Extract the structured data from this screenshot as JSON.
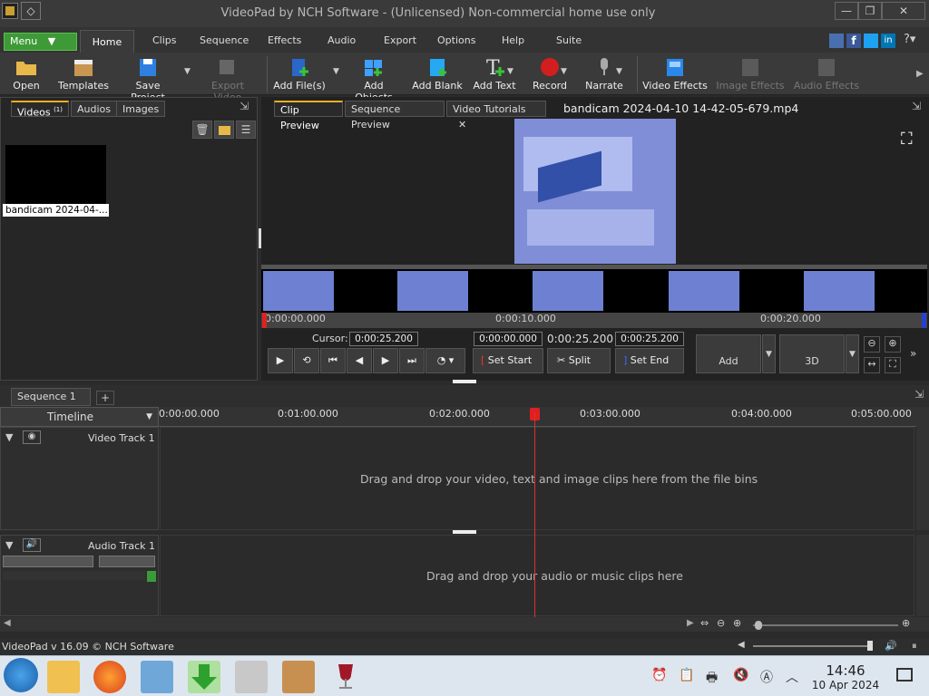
{
  "window": {
    "title": "VideoPad by NCH Software - (Unlicensed) Non-commercial home use only"
  },
  "menubar": {
    "menu_label": "Menu",
    "tabs": [
      "Home",
      "Clips",
      "Sequence",
      "Effects",
      "Audio",
      "Export",
      "Options",
      "Help",
      "Suite"
    ]
  },
  "toolbar": {
    "items": [
      {
        "label": "Open",
        "icon": "folder-icon"
      },
      {
        "label": "Templates",
        "icon": "templates-icon"
      },
      {
        "label": "Save Project",
        "icon": "floppy-icon"
      },
      {
        "label": "Export Video",
        "icon": "export-icon",
        "disabled": true
      },
      {
        "label": "Add File(s)",
        "icon": "add-file-icon"
      },
      {
        "label": "Add Objects",
        "icon": "add-objects-icon"
      },
      {
        "label": "Add Blank",
        "icon": "add-blank-icon"
      },
      {
        "label": "Add Text",
        "icon": "add-text-icon"
      },
      {
        "label": "Record",
        "icon": "record-icon"
      },
      {
        "label": "Narrate",
        "icon": "microphone-icon"
      },
      {
        "label": "Video Effects",
        "icon": "video-effects-icon"
      },
      {
        "label": "Image Effects",
        "icon": "image-effects-icon",
        "disabled": true
      },
      {
        "label": "Audio Effects",
        "icon": "audio-effects-icon",
        "disabled": true
      }
    ]
  },
  "bins": {
    "tabs": [
      "Videos",
      "Audios",
      "Images"
    ],
    "videos_count": "(1)",
    "clip_name": "bandicam 2024-04-..."
  },
  "preview": {
    "tabs": [
      "Clip Preview",
      "Sequence Preview",
      "Video Tutorials"
    ],
    "file_name": "bandicam 2024-04-10 14-42-05-679.mp4",
    "ruler": [
      "0:00:00.000",
      "0:00:10.000",
      "0:00:20.000"
    ],
    "cursor_label": "Cursor:",
    "cursor_value": "0:00:25.200",
    "start_value": "0:00:00.000",
    "duration_value": "0:00:25.200",
    "end_value": "0:00:25.200",
    "set_start": "Set Start",
    "split": "Split",
    "set_end": "Set End",
    "add": "Add",
    "three_d": "3D"
  },
  "sequence": {
    "tab": "Sequence 1",
    "timeline_label": "Timeline",
    "ruler": [
      "0:00:00.000",
      "0:01:00.000",
      "0:02:00.000",
      "0:03:00.000",
      "0:04:00.000",
      "0:05:00.000"
    ],
    "video_track": "Video Track 1",
    "video_hint": "Drag and drop your video, text and image clips here from the file bins",
    "audio_track": "Audio Track 1",
    "audio_hint": "Drag and drop your audio or music clips here"
  },
  "status": {
    "version": "VideoPad v 16.09 © NCH Software"
  },
  "taskbar": {
    "time": "14:46",
    "date": "10 Apr 2024"
  }
}
